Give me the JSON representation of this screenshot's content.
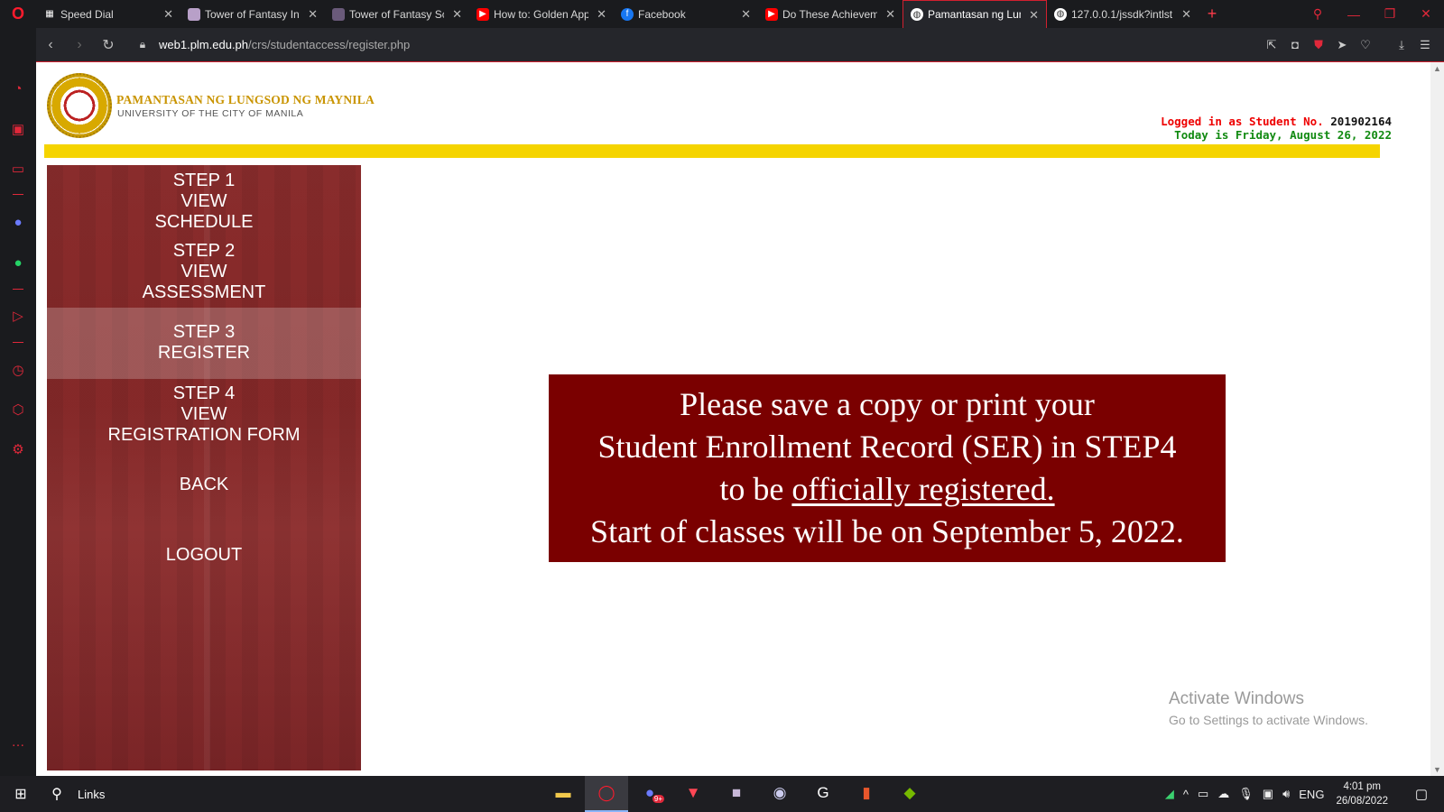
{
  "browser": {
    "tabs": [
      {
        "title": "Speed Dial",
        "icon": "speed-dial-icon",
        "color": "#ffffff"
      },
      {
        "title": "Tower of Fantasy Inte",
        "icon": "game-icon",
        "color": "#c0a0d0"
      },
      {
        "title": "Tower of Fantasy Sco",
        "icon": "game-icon",
        "color": "#7a6a8a"
      },
      {
        "title": "How to: Golden App",
        "icon": "youtube-icon",
        "color": "#ff0000"
      },
      {
        "title": "Facebook",
        "icon": "facebook-icon",
        "color": "#1877f2"
      },
      {
        "title": "Do These Achieveme",
        "icon": "youtube-icon",
        "color": "#ff0000"
      },
      {
        "title": "Pamantasan ng Lung",
        "icon": "globe-icon",
        "color": "#ffffff"
      },
      {
        "title": "127.0.0.1/jssdk?intlst",
        "icon": "globe-icon",
        "color": "#ffffff"
      }
    ],
    "active_tab": 6,
    "url_domain": "web1.plm.edu.ph",
    "url_path": "/crs/studentaccess/register.php"
  },
  "header": {
    "univ_name": "PAMANTASAN NG LUNGSOD NG MAYNILA",
    "univ_sub": "UNIVERSITY OF THE CITY OF MANILA",
    "login_label": "Logged in as Student No.",
    "student_no": "201902164",
    "today": "Today is Friday, August 26, 2022"
  },
  "menu": {
    "items": [
      {
        "lines": [
          "STEP 1",
          "VIEW",
          "SCHEDULE"
        ],
        "active": false
      },
      {
        "lines": [
          "STEP 2",
          "VIEW",
          "ASSESSMENT"
        ],
        "active": false
      },
      {
        "lines": [
          "STEP 3",
          "REGISTER"
        ],
        "active": true
      },
      {
        "lines": [
          "STEP 4",
          "VIEW",
          "REGISTRATION FORM"
        ],
        "active": false
      },
      {
        "lines": [
          "BACK"
        ],
        "active": false
      },
      {
        "lines": [
          "LOGOUT"
        ],
        "active": false
      }
    ]
  },
  "notice": {
    "line1": "Please save a copy or print your",
    "line2": "Student Enrollment Record (SER) in STEP4",
    "line3_pre": "to be ",
    "line3_u": "officially registered.",
    "line4": "Start of classes will be on September 5, 2022."
  },
  "watermark": {
    "title": "Activate Windows",
    "subtitle": "Go to Settings to activate Windows."
  },
  "taskbar": {
    "links_label": "Links",
    "lang": "ENG",
    "time": "4:01 pm",
    "date": "26/08/2022",
    "discord_badge": "9+"
  },
  "colors": {
    "accent": "#e0283a",
    "menu_bg": "#8b2b2b",
    "notice_bg": "#7a0000",
    "yellow_bar": "#f5d400"
  }
}
